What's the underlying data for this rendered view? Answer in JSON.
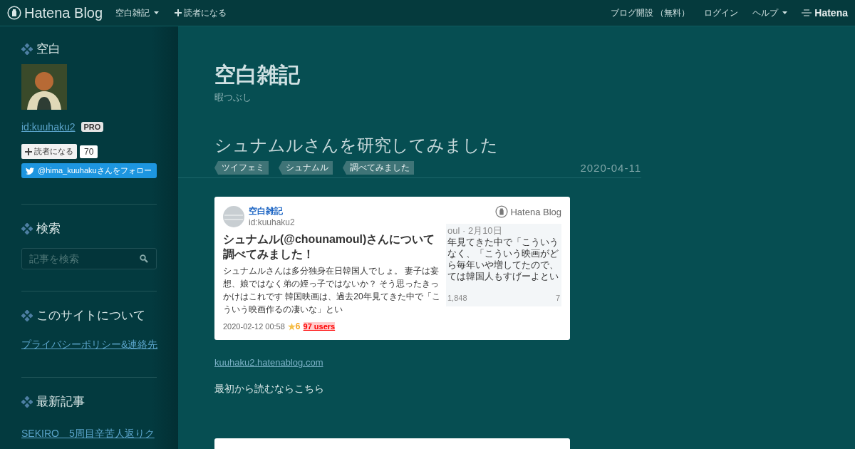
{
  "topbar": {
    "logo": "Hatena Blog",
    "blog_menu": "空白雑記",
    "subscribe": "読者になる",
    "links": [
      {
        "label": "ブログ開設 （無料）",
        "kind": "link"
      },
      {
        "label": "ログイン",
        "kind": "link"
      },
      {
        "label": "ヘルプ",
        "kind": "menu"
      }
    ],
    "brand": "Hatena"
  },
  "sidebar": {
    "profile": {
      "heading": "空白",
      "user_id": "id:kuuhaku2",
      "badge": "PRO",
      "subscribe_button": "読者になる",
      "subscriber_count": "70",
      "twitter_button": "@hima_kuuhakuさんをフォロー"
    },
    "search": {
      "heading": "検索",
      "placeholder": "記事を検索"
    },
    "about": {
      "heading": "このサイトについて",
      "link": "プライバシーポリシー&連絡先"
    },
    "recent": {
      "heading": "最新記事",
      "items": [
        "SEKIRO　5周目辛苦人返りク"
      ]
    }
  },
  "main": {
    "blog_title": "空白雑記",
    "tagline": "暇つぶし",
    "entry": {
      "title": "シュナムルさんを研究してみました",
      "tags": [
        "ツイフェミ",
        "シュナムル",
        "調べてみました"
      ],
      "date": "2020-04-11",
      "embed": {
        "blog_name": "空白雑記",
        "user_id": "id:kuuhaku2",
        "brand": "Hatena Blog",
        "title": "シュナムル(@chounamoul)さんについて調べてみました！",
        "excerpt": "シュナムルさんは多分独身在日韓国人でしょ。 妻子は妄想、娘ではなく弟の姪っ子ではないか？ そう思ったきっかけはこれです 韓国映画は、過去20年見てきた中で「こういう映画作るの凄いな」とい",
        "date": "2020-02-12 00:58",
        "star_count": "6",
        "bookmarks": "97 users",
        "thumbnail": {
          "header": "oul · 2月10日",
          "lines": [
            "年見てきた中で「こういう",
            "なく、「こういう映画がど",
            "ら毎年いや増してたので、",
            "ては韓国人もすげーよとい"
          ],
          "retweets": "1,848",
          "likes": "7"
        }
      },
      "link": "kuuhaku2.hatenablog.com",
      "text": "最初から読むならこちら"
    }
  }
}
